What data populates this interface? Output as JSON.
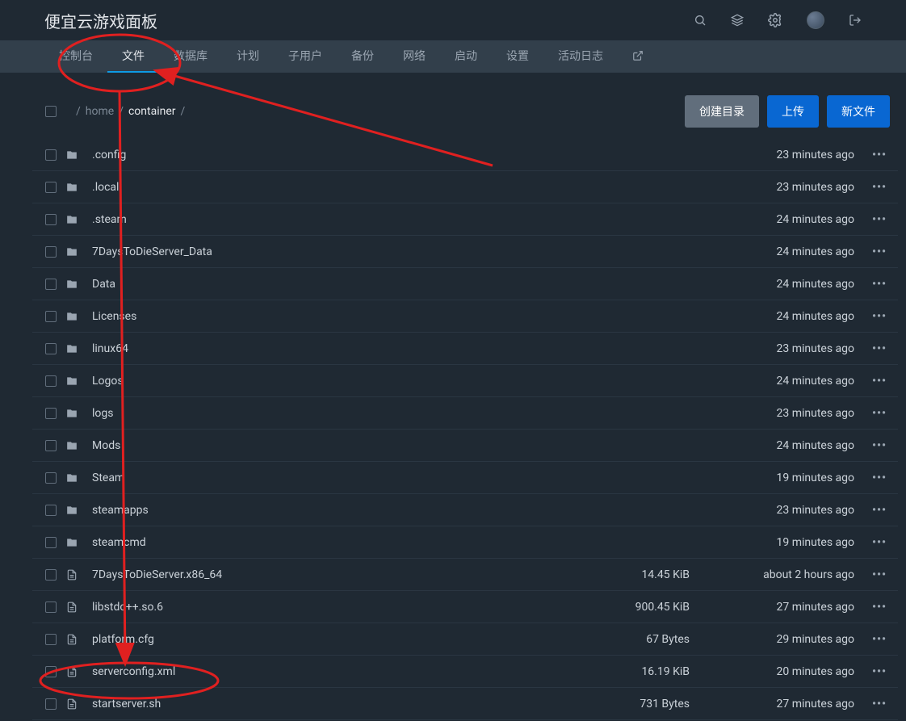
{
  "brand": "便宜云游戏面板",
  "nav": {
    "items": [
      {
        "label": "控制台"
      },
      {
        "label": "文件",
        "active": true
      },
      {
        "label": "数据库"
      },
      {
        "label": "计划"
      },
      {
        "label": "子用户"
      },
      {
        "label": "备份"
      },
      {
        "label": "网络"
      },
      {
        "label": "启动"
      },
      {
        "label": "设置"
      },
      {
        "label": "活动日志"
      }
    ]
  },
  "breadcrumb": {
    "sep1": "/",
    "home": "home",
    "sep2": "/",
    "container": "container",
    "sep3": "/"
  },
  "buttons": {
    "createDir": "创建目录",
    "upload": "上传",
    "newFile": "新文件"
  },
  "files": [
    {
      "type": "folder",
      "name": ".config",
      "size": "",
      "time": "23 minutes ago"
    },
    {
      "type": "folder",
      "name": ".local",
      "size": "",
      "time": "23 minutes ago"
    },
    {
      "type": "folder",
      "name": ".steam",
      "size": "",
      "time": "24 minutes ago"
    },
    {
      "type": "folder",
      "name": "7DaysToDieServer_Data",
      "size": "",
      "time": "24 minutes ago"
    },
    {
      "type": "folder",
      "name": "Data",
      "size": "",
      "time": "24 minutes ago"
    },
    {
      "type": "folder",
      "name": "Licenses",
      "size": "",
      "time": "24 minutes ago"
    },
    {
      "type": "folder",
      "name": "linux64",
      "size": "",
      "time": "23 minutes ago"
    },
    {
      "type": "folder",
      "name": "Logos",
      "size": "",
      "time": "24 minutes ago"
    },
    {
      "type": "folder",
      "name": "logs",
      "size": "",
      "time": "23 minutes ago"
    },
    {
      "type": "folder",
      "name": "Mods",
      "size": "",
      "time": "24 minutes ago"
    },
    {
      "type": "folder",
      "name": "Steam",
      "size": "",
      "time": "19 minutes ago"
    },
    {
      "type": "folder",
      "name": "steamapps",
      "size": "",
      "time": "23 minutes ago"
    },
    {
      "type": "folder",
      "name": "steamcmd",
      "size": "",
      "time": "19 minutes ago"
    },
    {
      "type": "file",
      "name": "7DaysToDieServer.x86_64",
      "size": "14.45 KiB",
      "time": "about 2 hours ago"
    },
    {
      "type": "file",
      "name": "libstdc++.so.6",
      "size": "900.45 KiB",
      "time": "27 minutes ago"
    },
    {
      "type": "file",
      "name": "platform.cfg",
      "size": "67 Bytes",
      "time": "29 minutes ago"
    },
    {
      "type": "file",
      "name": "serverconfig.xml",
      "size": "16.19 KiB",
      "time": "20 minutes ago"
    },
    {
      "type": "file",
      "name": "startserver.sh",
      "size": "731 Bytes",
      "time": "27 minutes ago"
    }
  ],
  "menuDots": "•••"
}
